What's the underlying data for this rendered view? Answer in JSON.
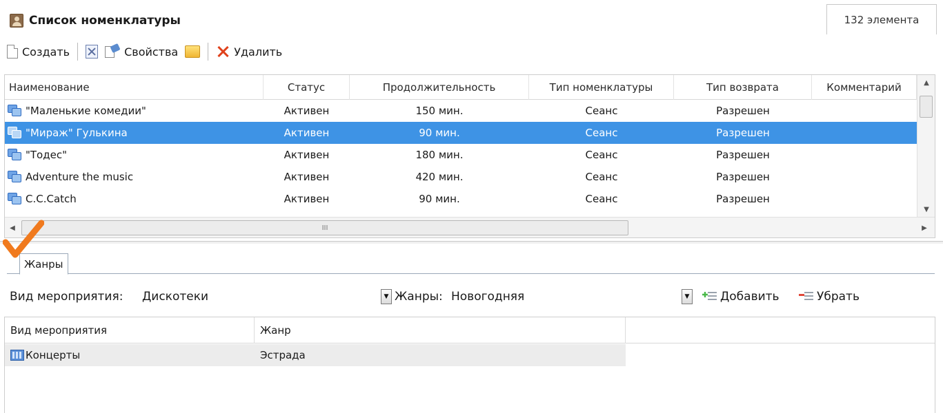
{
  "header": {
    "title": "Список номенклатуры",
    "count": "132 элемента"
  },
  "toolbar": {
    "create": "Создать",
    "properties": "Свойства",
    "delete": "Удалить"
  },
  "items_table": {
    "columns": [
      "Наименование",
      "Статус",
      "Продолжительность",
      "Тип номенклатуры",
      "Тип возврата",
      "Комментарий"
    ],
    "rows": [
      {
        "name": "\"Маленькие комедии\"",
        "status": "Активен",
        "duration": "150 мин.",
        "type": "Сеанс",
        "return": "Разрешен",
        "comment": ""
      },
      {
        "name": "\"Мираж\" Гулькина",
        "status": "Активен",
        "duration": "90 мин.",
        "type": "Сеанс",
        "return": "Разрешен",
        "comment": "",
        "selected": true
      },
      {
        "name": "\"Тодес\"",
        "status": "Активен",
        "duration": "180 мин.",
        "type": "Сеанс",
        "return": "Разрешен",
        "comment": ""
      },
      {
        "name": "Adventure the music",
        "status": "Активен",
        "duration": "420 мин.",
        "type": "Сеанс",
        "return": "Разрешен",
        "comment": ""
      },
      {
        "name": "C.C.Catch",
        "status": "Активен",
        "duration": "90 мин.",
        "type": "Сеанс",
        "return": "Разрешен",
        "comment": ""
      }
    ],
    "hscroll_grip": "III"
  },
  "tabs": {
    "genres": "Жанры"
  },
  "filter": {
    "event_type_label": "Вид мероприятия:",
    "event_type_value": "Дискотеки",
    "genres_label": "Жанры:",
    "genres_value": "Новогодняя",
    "add": "Добавить",
    "remove": "Убрать"
  },
  "genres_table": {
    "columns": [
      "Вид мероприятия",
      "Жанр"
    ],
    "rows": [
      {
        "event": "Концерты",
        "genre": "Эстрада"
      }
    ]
  },
  "colors": {
    "selection": "#3e93e5",
    "checkmark": "#f07a1e"
  }
}
